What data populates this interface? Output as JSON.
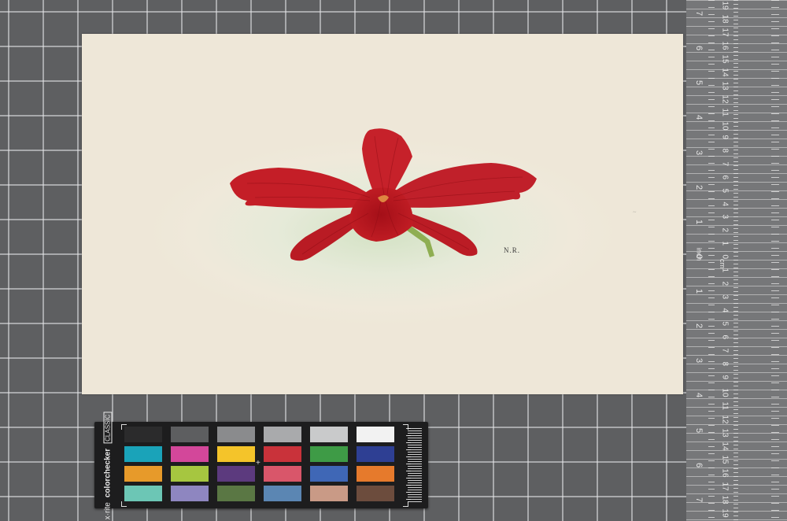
{
  "sheet": {
    "initials": "N.R."
  },
  "colorchecker": {
    "brand_1": "x·rite",
    "brand_2": "colorchecker",
    "brand_3": "CLASSIC",
    "swatches": [
      "#2b2b2c",
      "#5d5e60",
      "#8a8b8d",
      "#a9aaac",
      "#c9cacb",
      "#f2f2f2",
      "#1aa3b9",
      "#d3479a",
      "#f4c42a",
      "#c9323a",
      "#3e9b46",
      "#2e3f93",
      "#e79a2a",
      "#a6c640",
      "#5c3a7e",
      "#d9566a",
      "#3f67b6",
      "#e67a2c",
      "#6cc6b5",
      "#8e86c0",
      "#5a7744",
      "#5b86b3",
      "#c99a86",
      "#6c4c3d"
    ]
  },
  "ruler": {
    "inch_marks": [
      "7",
      "6",
      "5",
      "4",
      "3",
      "2",
      "1",
      "0",
      "1",
      "2",
      "3",
      "4",
      "5",
      "6",
      "7"
    ],
    "cm_marks": [
      "19",
      "18",
      "17",
      "16",
      "15",
      "14",
      "13",
      "12",
      "11",
      "10",
      "9",
      "8",
      "7",
      "6",
      "5",
      "4",
      "3",
      "2",
      "1",
      "0",
      "1",
      "2",
      "3",
      "4",
      "5",
      "6",
      "7",
      "8",
      "9",
      "10",
      "11",
      "12",
      "13",
      "14",
      "15",
      "16",
      "17",
      "18",
      "19"
    ],
    "unit_inch": "inch",
    "unit_cm": "cm"
  }
}
